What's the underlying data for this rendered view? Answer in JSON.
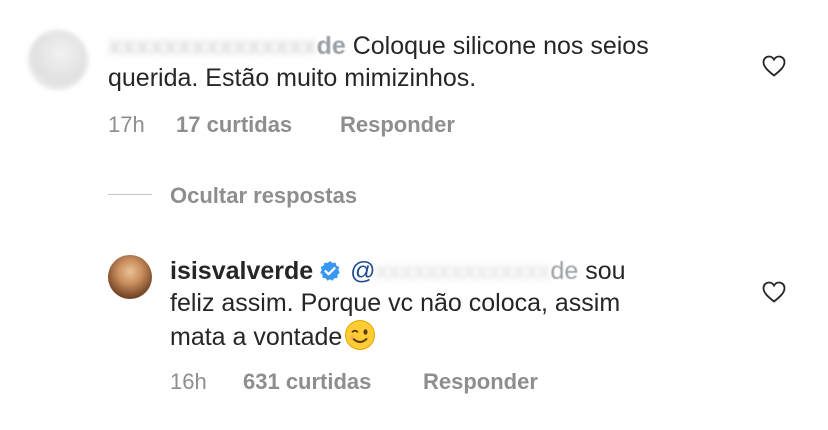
{
  "comment1": {
    "username_tail": "de",
    "text_line1": "Coloque silicone nos seios",
    "text_line2": "querida. Estão muito mimizinhos.",
    "time": "17h",
    "likes": "17 curtidas",
    "reply": "Responder"
  },
  "replies_toggle": "Ocultar respostas",
  "comment2": {
    "username": "isisvalverde",
    "mention_prefix": "@",
    "mention_tail": "de",
    "text_line1_end": "sou",
    "text_line2": "feliz assim. Porque vc não coloca, assim",
    "text_line3": "mata a vontade",
    "time": "16h",
    "likes": "631 curtidas",
    "reply": "Responder"
  },
  "icons": {
    "like": "heart-outline-icon",
    "verified": "verified-badge-icon",
    "emoji": "winking-face-emoji"
  },
  "colors": {
    "text": "#262626",
    "meta": "#8e8e8e",
    "verified": "#3897f0",
    "mention": "#1f4c8f"
  }
}
